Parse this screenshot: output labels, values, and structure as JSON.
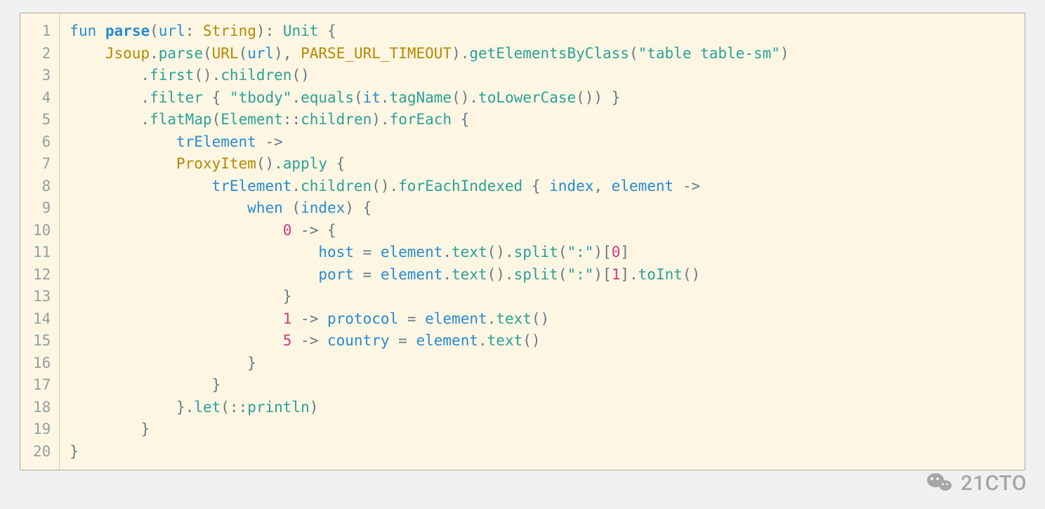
{
  "watermark": {
    "label": "21CTO"
  },
  "code": {
    "line_numbers": [
      "1",
      "2",
      "3",
      "4",
      "5",
      "6",
      "7",
      "8",
      "9",
      "10",
      "11",
      "12",
      "13",
      "14",
      "15",
      "16",
      "17",
      "18",
      "19",
      "20"
    ],
    "lines": [
      [
        {
          "t": "kw",
          "v": "fun"
        },
        {
          "t": "sp",
          "v": " "
        },
        {
          "t": "fn",
          "v": "parse"
        },
        {
          "t": "punc",
          "v": "("
        },
        {
          "t": "name",
          "v": "url"
        },
        {
          "t": "punc",
          "v": ":"
        },
        {
          "t": "sp",
          "v": " "
        },
        {
          "t": "cls",
          "v": "String"
        },
        {
          "t": "punc",
          "v": ")"
        },
        {
          "t": "punc",
          "v": ":"
        },
        {
          "t": "sp",
          "v": " "
        },
        {
          "t": "type",
          "v": "Unit"
        },
        {
          "t": "sp",
          "v": " "
        },
        {
          "t": "punc",
          "v": "{"
        }
      ],
      [
        {
          "t": "sp",
          "v": "    "
        },
        {
          "t": "cls",
          "v": "Jsoup"
        },
        {
          "t": "punc",
          "v": "."
        },
        {
          "t": "call",
          "v": "parse"
        },
        {
          "t": "punc",
          "v": "("
        },
        {
          "t": "cls",
          "v": "URL"
        },
        {
          "t": "punc",
          "v": "("
        },
        {
          "t": "name",
          "v": "url"
        },
        {
          "t": "punc",
          "v": ")"
        },
        {
          "t": "punc",
          "v": ","
        },
        {
          "t": "sp",
          "v": " "
        },
        {
          "t": "cls",
          "v": "PARSE_URL_TIMEOUT"
        },
        {
          "t": "punc",
          "v": ")"
        },
        {
          "t": "punc",
          "v": "."
        },
        {
          "t": "call",
          "v": "getElementsByClass"
        },
        {
          "t": "punc",
          "v": "("
        },
        {
          "t": "str",
          "v": "\"table table-sm\""
        },
        {
          "t": "punc",
          "v": ")"
        }
      ],
      [
        {
          "t": "sp",
          "v": "        "
        },
        {
          "t": "punc",
          "v": "."
        },
        {
          "t": "call",
          "v": "first"
        },
        {
          "t": "punc",
          "v": "()"
        },
        {
          "t": "punc",
          "v": "."
        },
        {
          "t": "call",
          "v": "children"
        },
        {
          "t": "punc",
          "v": "()"
        }
      ],
      [
        {
          "t": "sp",
          "v": "        "
        },
        {
          "t": "punc",
          "v": "."
        },
        {
          "t": "call",
          "v": "filter"
        },
        {
          "t": "sp",
          "v": " "
        },
        {
          "t": "punc",
          "v": "{"
        },
        {
          "t": "sp",
          "v": " "
        },
        {
          "t": "str",
          "v": "\"tbody\""
        },
        {
          "t": "punc",
          "v": "."
        },
        {
          "t": "call",
          "v": "equals"
        },
        {
          "t": "punc",
          "v": "("
        },
        {
          "t": "name",
          "v": "it"
        },
        {
          "t": "punc",
          "v": "."
        },
        {
          "t": "call",
          "v": "tagName"
        },
        {
          "t": "punc",
          "v": "()"
        },
        {
          "t": "punc",
          "v": "."
        },
        {
          "t": "call",
          "v": "toLowerCase"
        },
        {
          "t": "punc",
          "v": "()"
        },
        {
          "t": "punc",
          "v": ")"
        },
        {
          "t": "sp",
          "v": " "
        },
        {
          "t": "punc",
          "v": "}"
        }
      ],
      [
        {
          "t": "sp",
          "v": "        "
        },
        {
          "t": "punc",
          "v": "."
        },
        {
          "t": "call",
          "v": "flatMap"
        },
        {
          "t": "punc",
          "v": "("
        },
        {
          "t": "type",
          "v": "Element"
        },
        {
          "t": "op",
          "v": "::"
        },
        {
          "t": "call",
          "v": "children"
        },
        {
          "t": "punc",
          "v": ")"
        },
        {
          "t": "punc",
          "v": "."
        },
        {
          "t": "call",
          "v": "forEach"
        },
        {
          "t": "sp",
          "v": " "
        },
        {
          "t": "punc",
          "v": "{"
        }
      ],
      [
        {
          "t": "sp",
          "v": "            "
        },
        {
          "t": "name",
          "v": "trElement"
        },
        {
          "t": "sp",
          "v": " "
        },
        {
          "t": "op",
          "v": "->"
        }
      ],
      [
        {
          "t": "sp",
          "v": "            "
        },
        {
          "t": "cls",
          "v": "ProxyItem"
        },
        {
          "t": "punc",
          "v": "()"
        },
        {
          "t": "punc",
          "v": "."
        },
        {
          "t": "call",
          "v": "apply"
        },
        {
          "t": "sp",
          "v": " "
        },
        {
          "t": "punc",
          "v": "{"
        }
      ],
      [
        {
          "t": "sp",
          "v": "                "
        },
        {
          "t": "name",
          "v": "trElement"
        },
        {
          "t": "punc",
          "v": "."
        },
        {
          "t": "call",
          "v": "children"
        },
        {
          "t": "punc",
          "v": "()"
        },
        {
          "t": "punc",
          "v": "."
        },
        {
          "t": "call",
          "v": "forEachIndexed"
        },
        {
          "t": "sp",
          "v": " "
        },
        {
          "t": "punc",
          "v": "{"
        },
        {
          "t": "sp",
          "v": " "
        },
        {
          "t": "name",
          "v": "index"
        },
        {
          "t": "punc",
          "v": ","
        },
        {
          "t": "sp",
          "v": " "
        },
        {
          "t": "name",
          "v": "element"
        },
        {
          "t": "sp",
          "v": " "
        },
        {
          "t": "op",
          "v": "->"
        }
      ],
      [
        {
          "t": "sp",
          "v": "                    "
        },
        {
          "t": "kw",
          "v": "when"
        },
        {
          "t": "sp",
          "v": " "
        },
        {
          "t": "punc",
          "v": "("
        },
        {
          "t": "name",
          "v": "index"
        },
        {
          "t": "punc",
          "v": ")"
        },
        {
          "t": "sp",
          "v": " "
        },
        {
          "t": "punc",
          "v": "{"
        }
      ],
      [
        {
          "t": "sp",
          "v": "                        "
        },
        {
          "t": "num",
          "v": "0"
        },
        {
          "t": "sp",
          "v": " "
        },
        {
          "t": "op",
          "v": "->"
        },
        {
          "t": "sp",
          "v": " "
        },
        {
          "t": "punc",
          "v": "{"
        }
      ],
      [
        {
          "t": "sp",
          "v": "                            "
        },
        {
          "t": "name",
          "v": "host"
        },
        {
          "t": "sp",
          "v": " "
        },
        {
          "t": "op",
          "v": "="
        },
        {
          "t": "sp",
          "v": " "
        },
        {
          "t": "name",
          "v": "element"
        },
        {
          "t": "punc",
          "v": "."
        },
        {
          "t": "call",
          "v": "text"
        },
        {
          "t": "punc",
          "v": "()"
        },
        {
          "t": "punc",
          "v": "."
        },
        {
          "t": "call",
          "v": "split"
        },
        {
          "t": "punc",
          "v": "("
        },
        {
          "t": "str",
          "v": "\":\""
        },
        {
          "t": "punc",
          "v": ")"
        },
        {
          "t": "punc",
          "v": "["
        },
        {
          "t": "num",
          "v": "0"
        },
        {
          "t": "punc",
          "v": "]"
        }
      ],
      [
        {
          "t": "sp",
          "v": "                            "
        },
        {
          "t": "name",
          "v": "port"
        },
        {
          "t": "sp",
          "v": " "
        },
        {
          "t": "op",
          "v": "="
        },
        {
          "t": "sp",
          "v": " "
        },
        {
          "t": "name",
          "v": "element"
        },
        {
          "t": "punc",
          "v": "."
        },
        {
          "t": "call",
          "v": "text"
        },
        {
          "t": "punc",
          "v": "()"
        },
        {
          "t": "punc",
          "v": "."
        },
        {
          "t": "call",
          "v": "split"
        },
        {
          "t": "punc",
          "v": "("
        },
        {
          "t": "str",
          "v": "\":\""
        },
        {
          "t": "punc",
          "v": ")"
        },
        {
          "t": "punc",
          "v": "["
        },
        {
          "t": "num",
          "v": "1"
        },
        {
          "t": "punc",
          "v": "]"
        },
        {
          "t": "punc",
          "v": "."
        },
        {
          "t": "call",
          "v": "toInt"
        },
        {
          "t": "punc",
          "v": "()"
        }
      ],
      [
        {
          "t": "sp",
          "v": "                        "
        },
        {
          "t": "punc",
          "v": "}"
        }
      ],
      [
        {
          "t": "sp",
          "v": "                        "
        },
        {
          "t": "num",
          "v": "1"
        },
        {
          "t": "sp",
          "v": " "
        },
        {
          "t": "op",
          "v": "->"
        },
        {
          "t": "sp",
          "v": " "
        },
        {
          "t": "name",
          "v": "protocol"
        },
        {
          "t": "sp",
          "v": " "
        },
        {
          "t": "op",
          "v": "="
        },
        {
          "t": "sp",
          "v": " "
        },
        {
          "t": "name",
          "v": "element"
        },
        {
          "t": "punc",
          "v": "."
        },
        {
          "t": "call",
          "v": "text"
        },
        {
          "t": "punc",
          "v": "()"
        }
      ],
      [
        {
          "t": "sp",
          "v": "                        "
        },
        {
          "t": "num",
          "v": "5"
        },
        {
          "t": "sp",
          "v": " "
        },
        {
          "t": "op",
          "v": "->"
        },
        {
          "t": "sp",
          "v": " "
        },
        {
          "t": "name",
          "v": "country"
        },
        {
          "t": "sp",
          "v": " "
        },
        {
          "t": "op",
          "v": "="
        },
        {
          "t": "sp",
          "v": " "
        },
        {
          "t": "name",
          "v": "element"
        },
        {
          "t": "punc",
          "v": "."
        },
        {
          "t": "call",
          "v": "text"
        },
        {
          "t": "punc",
          "v": "()"
        }
      ],
      [
        {
          "t": "sp",
          "v": "                    "
        },
        {
          "t": "punc",
          "v": "}"
        }
      ],
      [
        {
          "t": "sp",
          "v": "                "
        },
        {
          "t": "punc",
          "v": "}"
        }
      ],
      [
        {
          "t": "sp",
          "v": "            "
        },
        {
          "t": "punc",
          "v": "}"
        },
        {
          "t": "punc",
          "v": "."
        },
        {
          "t": "call",
          "v": "let"
        },
        {
          "t": "punc",
          "v": "("
        },
        {
          "t": "op",
          "v": "::"
        },
        {
          "t": "call",
          "v": "println"
        },
        {
          "t": "punc",
          "v": ")"
        }
      ],
      [
        {
          "t": "sp",
          "v": "        "
        },
        {
          "t": "punc",
          "v": "}"
        }
      ],
      [
        {
          "t": "punc",
          "v": "}"
        }
      ]
    ]
  }
}
